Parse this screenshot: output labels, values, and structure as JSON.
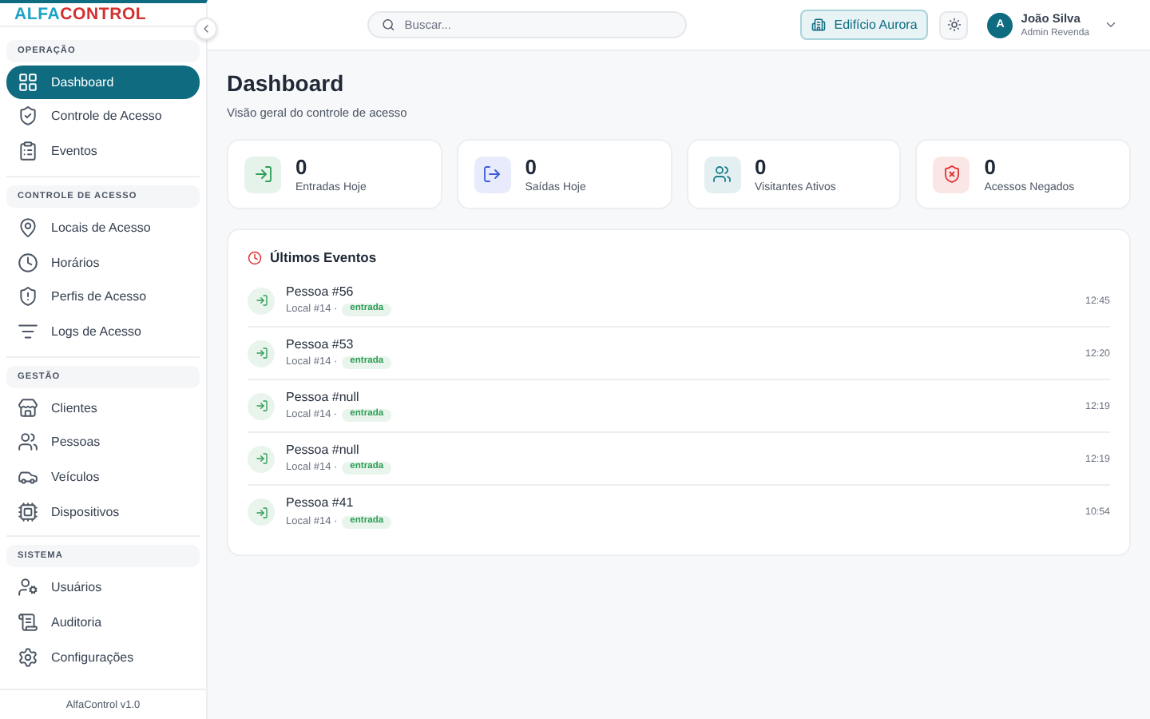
{
  "logo": {
    "part_1": "ALFA",
    "part_2": "CONTROL"
  },
  "sidebar": {
    "sections": [
      {
        "title": "OPERAÇÃO",
        "items": [
          {
            "label": "Dashboard",
            "selected": true
          },
          {
            "label": "Controle de Acesso",
            "selected": false
          },
          {
            "label": "Eventos",
            "selected": false
          }
        ]
      },
      {
        "title": "CONTROLE DE ACESSO",
        "items": [
          {
            "label": "Locais de Acesso",
            "selected": false
          },
          {
            "label": "Horários",
            "selected": false
          },
          {
            "label": "Perfis de Acesso",
            "selected": false
          },
          {
            "label": "Logs de Acesso",
            "selected": false
          }
        ]
      },
      {
        "title": "GESTÃO",
        "items": [
          {
            "label": "Clientes",
            "selected": false
          },
          {
            "label": "Pessoas",
            "selected": false
          },
          {
            "label": "Veículos",
            "selected": false
          },
          {
            "label": "Dispositivos",
            "selected": false
          }
        ]
      },
      {
        "title": "SISTEMA",
        "items": [
          {
            "label": "Usuários",
            "selected": false
          },
          {
            "label": "Auditoria",
            "selected": false
          },
          {
            "label": "Configurações",
            "selected": false
          }
        ]
      }
    ],
    "footer": "AlfaControl v1.0"
  },
  "header": {
    "search": {
      "placeholder": "Buscar..."
    },
    "building": "Edifício Aurora",
    "user": {
      "avatar": "A",
      "name": "João Silva",
      "role": "Admin Revenda"
    }
  },
  "page": {
    "title": "Dashboard",
    "subtitle": "Visão geral do controle de acesso"
  },
  "stats": [
    {
      "value": "0",
      "label": "Entradas Hoje",
      "color": "#2e9d57"
    },
    {
      "value": "0",
      "label": "Saídas Hoje",
      "color": "#3b5bdb"
    },
    {
      "value": "0",
      "label": "Visitantes Ativos",
      "color": "#1a7f8e"
    },
    {
      "value": "0",
      "label": "Acessos Negados",
      "color": "#e03131"
    }
  ],
  "events": {
    "title": "Últimos Eventos",
    "items": [
      {
        "person": "Pessoa #56",
        "place": "Local #14 ·",
        "tag": "entrada",
        "time": "12:45"
      },
      {
        "person": "Pessoa #53",
        "place": "Local #14 ·",
        "tag": "entrada",
        "time": "12:20"
      },
      {
        "person": "Pessoa #null",
        "place": "Local #14 ·",
        "tag": "entrada",
        "time": "12:19"
      },
      {
        "person": "Pessoa #null",
        "place": "Local #14 ·",
        "tag": "entrada",
        "time": "12:19"
      },
      {
        "person": "Pessoa #41",
        "place": "Local #14 ·",
        "tag": "entrada",
        "time": "10:54"
      }
    ]
  }
}
